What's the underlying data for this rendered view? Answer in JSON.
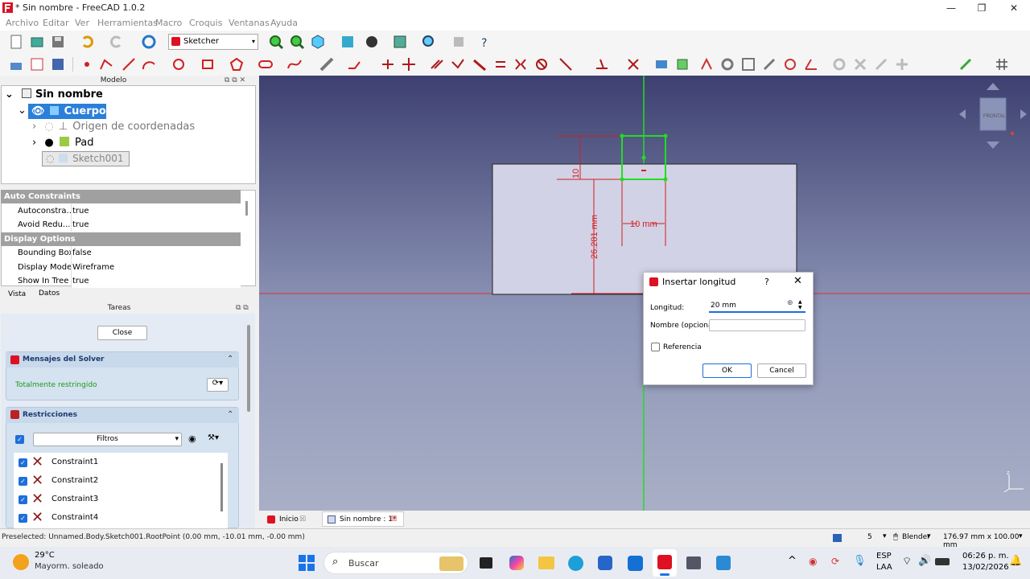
{
  "window": {
    "title": "* Sin nombre - FreeCAD 1.0.2",
    "min": "—",
    "max": "❐",
    "close": "✕"
  },
  "menu": [
    "Archivo",
    "Editar",
    "Ver",
    "Herramientas",
    "Macro",
    "Croquis",
    "Ventanas",
    "Ayuda"
  ],
  "toolbar": {
    "workbench": "Sketcher"
  },
  "model_panel": {
    "title": "Modelo"
  },
  "tree": {
    "root": "Sin nombre",
    "items": [
      {
        "label": "Cuerpo"
      },
      {
        "label": "Origen de coordenadas"
      },
      {
        "label": "Pad"
      },
      {
        "label": "Sketch001"
      }
    ]
  },
  "props": {
    "group1": "Auto Constraints",
    "rows1": [
      {
        "k": "Autoconstra...",
        "v": "true"
      },
      {
        "k": "Avoid Redu...",
        "v": "true"
      }
    ],
    "group2": "Display Options",
    "rows2": [
      {
        "k": "Bounding Box",
        "v": "false"
      },
      {
        "k": "Display Mode",
        "v": "Wireframe"
      },
      {
        "k": "Show In Tree",
        "v": "true"
      }
    ],
    "tab_vista": "Vista",
    "tab_datos": "Datos"
  },
  "tasks": {
    "title": "Tareas",
    "close": "Close",
    "solver_title": "Mensajes del Solver",
    "solver_status": "Totalmente restringido",
    "constraints_title": "Restricciones",
    "filter": "Filtros",
    "constraints": [
      "Constraint1",
      "Constraint2",
      "Constraint3",
      "Constraint4"
    ]
  },
  "sketch": {
    "dim_h": "10 mm",
    "dim_v": "26.281 mm",
    "dim_small": "10",
    "cube": "FRONTAL"
  },
  "dialog": {
    "title": "Insertar longitud",
    "help": "?",
    "close": "✕",
    "length_label": "Longitud:",
    "length_value": "20 mm",
    "name_label": "Nombre (opcional)",
    "ref_label": "Referencia",
    "ok": "OK",
    "cancel": "Cancel"
  },
  "doc_tabs": [
    "Inicio",
    "Sin nombre : 1*"
  ],
  "status": {
    "preselected": "Preselected: Unnamed.Body.Sketch001.RootPoint (0.00 mm, -10.01 mm, -0.00 mm)",
    "layers": "5",
    "nav": "Blender",
    "dims": "176.97 mm x 100.00 mm"
  },
  "taskbar": {
    "temp": "29°C",
    "weather": "Mayorm. soleado",
    "search": "Buscar",
    "lang1": "ESP",
    "lang2": "LAA",
    "time": "06:26 p. m.",
    "date": "13/02/2026"
  },
  "colors": {
    "accent": "#1e6fd9",
    "dim": "#d21f1f",
    "sketch": "#22dd22"
  }
}
